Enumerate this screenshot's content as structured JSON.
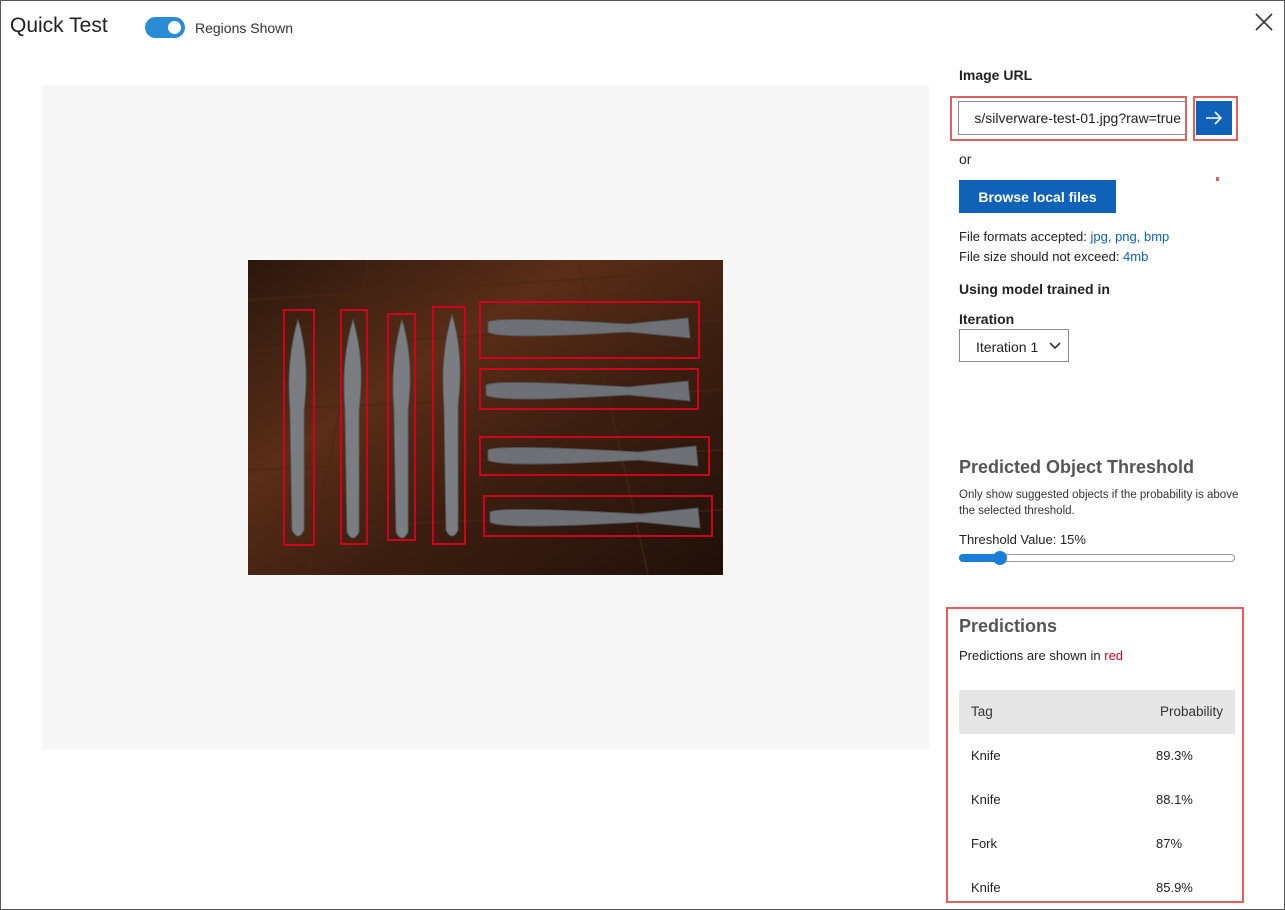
{
  "header": {
    "title": "Quick Test",
    "toggle_label": "Regions Shown",
    "toggle_on": true
  },
  "image_url": {
    "label": "Image URL",
    "value": "s/silverware-test-01.jpg?raw=true",
    "or_text": "or",
    "browse_label": "Browse local files",
    "formats_text": "File formats accepted: ",
    "formats_links": "jpg, png, bmp",
    "size_text": "File size should not exceed: ",
    "size_link": "4mb"
  },
  "model": {
    "heading": "Using model trained in",
    "iteration_label": "Iteration",
    "iteration_selected": "Iteration 1"
  },
  "threshold": {
    "heading": "Predicted Object Threshold",
    "description": "Only show suggested objects if the probability is above the selected threshold.",
    "value_label": "Threshold Value: 15%",
    "value_percent": 15
  },
  "predictions": {
    "heading": "Predictions",
    "note_prefix": "Predictions are shown in ",
    "note_color_word": "red",
    "columns": {
      "tag": "Tag",
      "probability": "Probability"
    },
    "rows": [
      {
        "tag": "Knife",
        "probability": "89.3%"
      },
      {
        "tag": "Knife",
        "probability": "88.1%"
      },
      {
        "tag": "Fork",
        "probability": "87%"
      },
      {
        "tag": "Knife",
        "probability": "85.9%"
      }
    ]
  },
  "colors": {
    "accent": "#0f62b8",
    "toggle": "#2a8bd6",
    "highlight": "#e06060",
    "region_box": "#d0021b"
  },
  "icons": [
    "close-icon",
    "arrow-right-icon",
    "chevron-down-icon"
  ]
}
